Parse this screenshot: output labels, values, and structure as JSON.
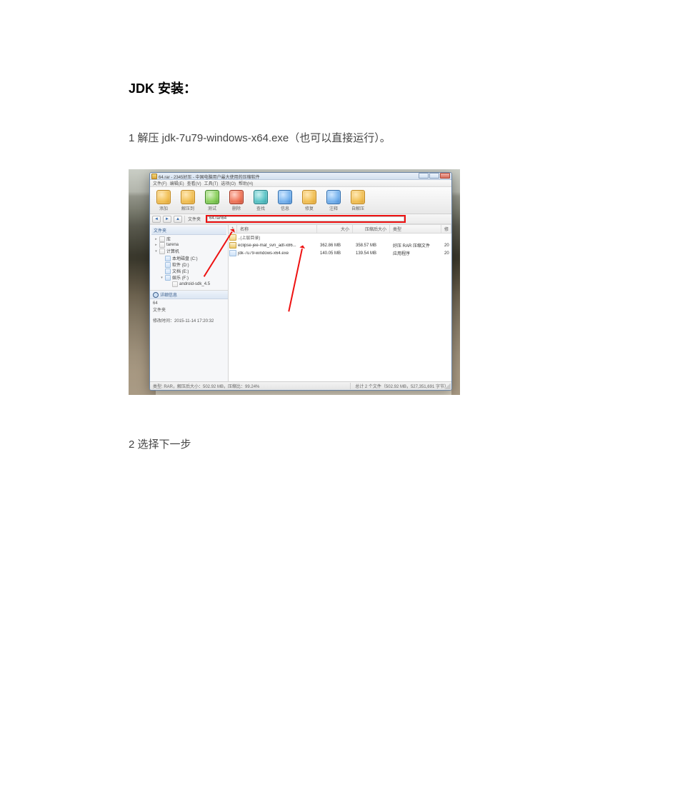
{
  "doc": {
    "heading": "JDK 安装：",
    "step1": "1  解压 jdk-7u79-windows-x64.exe（也可以直接运行）。",
    "step2": "2  选择下一步"
  },
  "window": {
    "title": "64.rar - 2345好压 - 中国电脑用户最大使用的压缩软件",
    "menus": [
      "文件(F)",
      "编辑(E)",
      "查看(V)",
      "工具(T)",
      "选项(O)",
      "帮助(H)"
    ],
    "toolbar": [
      {
        "id": "add",
        "label": "添加",
        "style": "default"
      },
      {
        "id": "extract",
        "label": "解压到",
        "style": "default"
      },
      {
        "id": "test",
        "label": "测试",
        "style": "green"
      },
      {
        "id": "delete",
        "label": "删除",
        "style": "red"
      },
      {
        "id": "find",
        "label": "查找",
        "style": "cyan"
      },
      {
        "id": "info",
        "label": "信息",
        "style": "blue"
      },
      {
        "id": "repair",
        "label": "修复",
        "style": "default"
      },
      {
        "id": "comment",
        "label": "注释",
        "style": "blue"
      },
      {
        "id": "sfx",
        "label": "自解压",
        "style": "default"
      }
    ],
    "nav": {
      "back_glyph": "◄",
      "fwd_glyph": "►",
      "up_glyph": "▲",
      "folders_label": "文件夹",
      "address": "64.rar\\64"
    },
    "tree": {
      "header": "文件夹",
      "items": [
        {
          "label": "库",
          "expandable": true
        },
        {
          "label": "tarena",
          "expandable": true
        },
        {
          "label": "计算机",
          "expandable": true,
          "children": [
            {
              "label": "本地磁盘 (C:)"
            },
            {
              "label": "软件 (D:)"
            },
            {
              "label": "文档 (E:)"
            },
            {
              "label": "娱乐 (F:)",
              "children": [
                {
                  "label": "android-sdk_4.5"
                }
              ]
            }
          ]
        }
      ]
    },
    "details": {
      "header": "详细信息",
      "name": "64",
      "type": "文件夹",
      "modified_label": "修改时间：",
      "modified": "2015-11-14 17:20:32"
    },
    "columns": {
      "icon": "*",
      "name": "名称",
      "size": "大小",
      "csize": "压缩后大小",
      "type": "类型",
      "date": "修"
    },
    "uprow": "..(上层目录)",
    "files": [
      {
        "name": "eclipse-jee-mat_svn_adt-x86...",
        "size": "362.86 MB",
        "csize": "358.57 MB",
        "type": "好压 RAR 压缩文件",
        "date": "20",
        "kind": "rar"
      },
      {
        "name": "jdk-7u79-windows-x64.exe",
        "size": "140.05 MB",
        "csize": "139.54 MB",
        "type": "应用程序",
        "date": "20",
        "kind": "exe"
      }
    ],
    "status": {
      "left": "类型: RAR，解压后大小：502.92 MB，压缩比：99.24%",
      "right": "总计 2 个文件（502.92 MB，527,351,691 字节）"
    }
  }
}
